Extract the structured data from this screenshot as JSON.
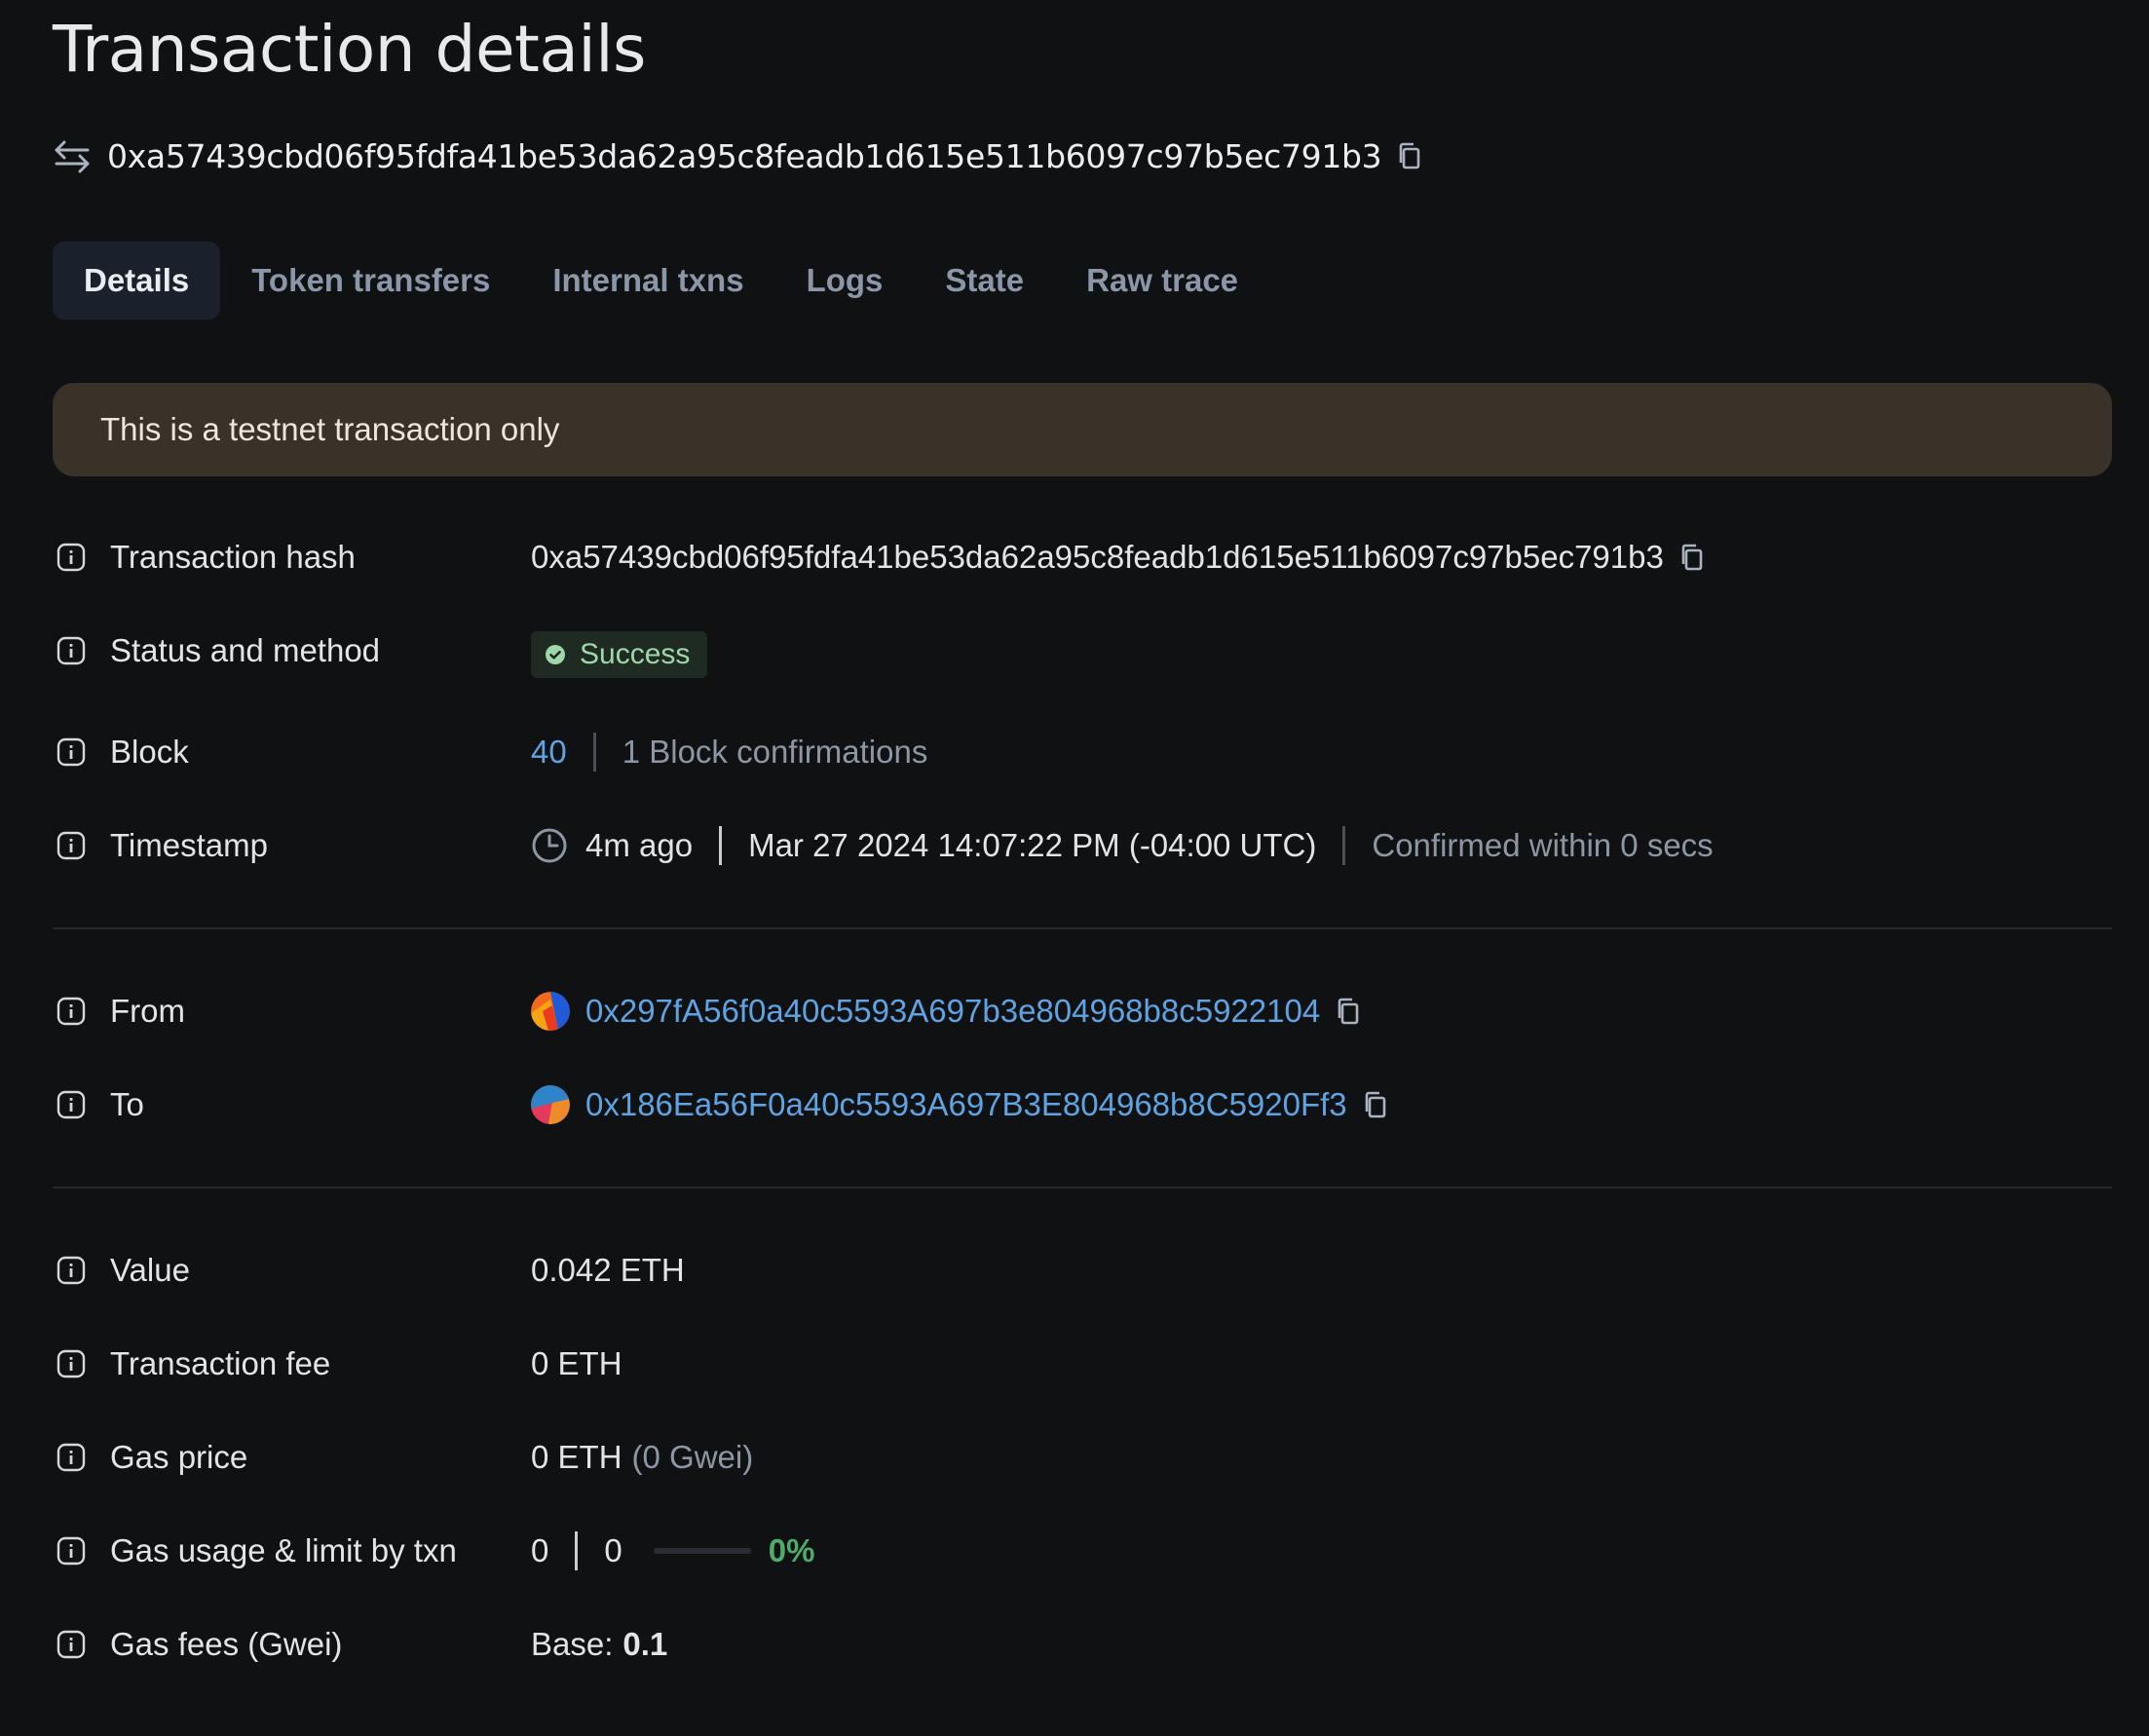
{
  "page": {
    "title": "Transaction details",
    "tx_hash": "0xa57439cbd06f95fdfa41be53da62a95c8feadb1d615e511b6097c97b5ec791b3"
  },
  "tabs": [
    {
      "label": "Details",
      "active": true
    },
    {
      "label": "Token transfers",
      "active": false
    },
    {
      "label": "Internal txns",
      "active": false
    },
    {
      "label": "Logs",
      "active": false
    },
    {
      "label": "State",
      "active": false
    },
    {
      "label": "Raw trace",
      "active": false
    }
  ],
  "banner": {
    "text": "This is a testnet transaction only"
  },
  "details": {
    "tx_hash": {
      "label": "Transaction hash",
      "value": "0xa57439cbd06f95fdfa41be53da62a95c8feadb1d615e511b6097c97b5ec791b3"
    },
    "status": {
      "label": "Status and method",
      "value": "Success"
    },
    "block": {
      "label": "Block",
      "number": "40",
      "confirmations": "1 Block confirmations"
    },
    "timestamp": {
      "label": "Timestamp",
      "relative": "4m ago",
      "absolute": "Mar 27 2024 14:07:22 PM (-04:00 UTC)",
      "confirmed": "Confirmed within 0 secs"
    },
    "from": {
      "label": "From",
      "address": "0x297fA56f0a40c5593A697b3e804968b8c5922104"
    },
    "to": {
      "label": "To",
      "address": "0x186Ea56F0a40c5593A697B3E804968b8C5920Ff3"
    },
    "value": {
      "label": "Value",
      "amount": "0.042 ETH"
    },
    "fee": {
      "label": "Transaction fee",
      "amount": "0 ETH"
    },
    "gas_price": {
      "label": "Gas price",
      "amount": "0 ETH",
      "gwei": "(0 Gwei)"
    },
    "gas_usage": {
      "label": "Gas usage & limit by txn",
      "used": "0",
      "limit": "0",
      "percent": "0%",
      "fraction": 0
    },
    "gas_fees": {
      "label": "Gas fees (Gwei)",
      "base_label": "Base:",
      "base_value": "0.1"
    }
  },
  "colors": {
    "background": "#101112",
    "link": "#5fa3e3",
    "success": "#4fab6a",
    "banner": "#3a3128",
    "active_tab": "#1a202c"
  }
}
